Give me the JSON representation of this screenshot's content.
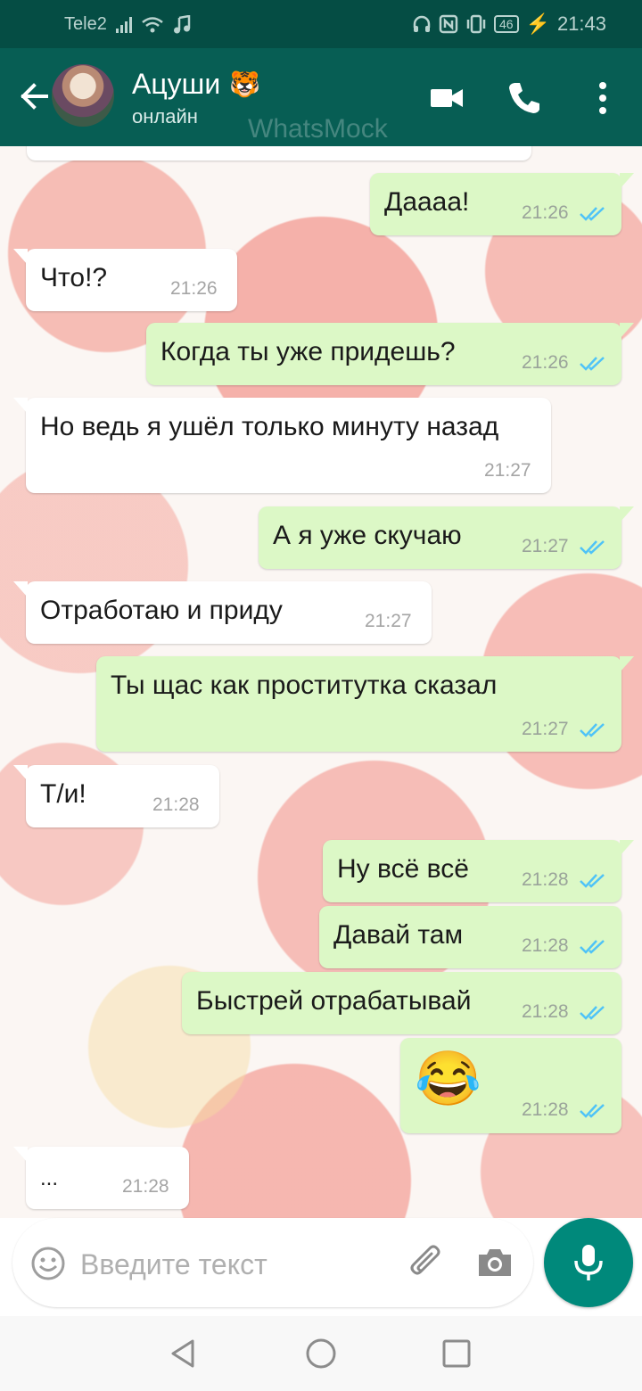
{
  "status": {
    "carrier": "Tele2",
    "battery": "46",
    "time": "21:43"
  },
  "header": {
    "title": "Ацуши",
    "title_emoji": "🐯",
    "subtitle": "онлайн",
    "watermark": "WhatsMock"
  },
  "messages": [
    {
      "dir": "out",
      "text": "Даааа!",
      "time": "21:26"
    },
    {
      "dir": "in",
      "text": "Что!?",
      "time": "21:26"
    },
    {
      "dir": "out",
      "text": "Когда ты уже придешь?",
      "time": "21:26"
    },
    {
      "dir": "in",
      "text": "Но ведь я ушёл только минуту назад",
      "time": "21:27"
    },
    {
      "dir": "out",
      "text": "А я уже скучаю",
      "time": "21:27"
    },
    {
      "dir": "in",
      "text": "Отработаю и приду",
      "time": "21:27"
    },
    {
      "dir": "out",
      "text": "Ты щас как проститутка сказал",
      "time": "21:27"
    },
    {
      "dir": "in",
      "text": "Т/и!",
      "time": "21:28"
    },
    {
      "dir": "out",
      "text": "Ну всё всё",
      "time": "21:28"
    },
    {
      "dir": "out",
      "text": "Давай там",
      "time": "21:28"
    },
    {
      "dir": "out",
      "text": "Быстрей отрабатывай",
      "time": "21:28"
    },
    {
      "dir": "out",
      "text": "😂",
      "time": "21:28"
    },
    {
      "dir": "in",
      "text": "...",
      "time": "21:28"
    }
  ],
  "input": {
    "placeholder": "Введите текст"
  },
  "colors": {
    "header": "#075e54",
    "statusbar": "#054d44",
    "outgoing": "#dcf8c6",
    "incoming": "#ffffff",
    "tick": "#4fc3f7",
    "mic": "#00897b"
  },
  "icons": [
    "back-arrow-icon",
    "video-call-icon",
    "phone-icon",
    "more-vert-icon",
    "emoji-icon",
    "attach-icon",
    "camera-icon",
    "mic-icon"
  ]
}
